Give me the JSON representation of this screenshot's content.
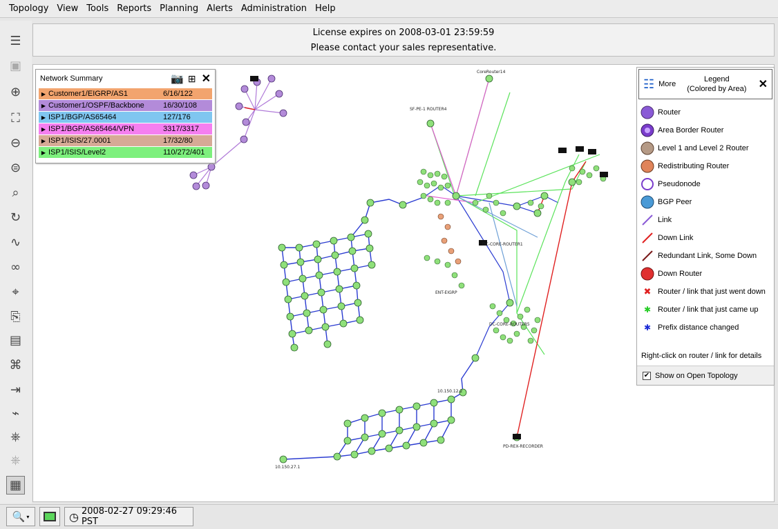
{
  "menu": [
    "Topology",
    "View",
    "Tools",
    "Reports",
    "Planning",
    "Alerts",
    "Administration",
    "Help"
  ],
  "notice": {
    "line1": "License expires on 2008-03-01 23:59:59",
    "line2": "Please contact your sales representative."
  },
  "toolbar": {
    "icons": [
      "tree-icon",
      "save-icon",
      "zoom-in-icon",
      "fit-icon",
      "zoom-out-icon",
      "zoom-region-icon",
      "search-icon",
      "refresh-icon",
      "waveform-icon",
      "path-icon",
      "inspect-icon",
      "router-add-icon",
      "report-icon",
      "topology-icon",
      "list-add-icon",
      "route-icon",
      "group-icon",
      "group-disabled-icon",
      "summary-icon"
    ]
  },
  "summary": {
    "title": "Network Summary",
    "rows": [
      {
        "name": "Customer1/EIGRP/AS1",
        "value": "6/16/122",
        "color": "#f2a46e"
      },
      {
        "name": "Customer1/OSPF/Backbone",
        "value": "16/30/108",
        "color": "#b38bd9"
      },
      {
        "name": "ISP1/BGP/AS65464",
        "value": "127/176",
        "color": "#7fc6f0"
      },
      {
        "name": "ISP1/BGP/AS65464/VPN",
        "value": "3317/3317",
        "color": "#f57ff0"
      },
      {
        "name": "ISP1/ISIS/27.0001",
        "value": "17/32/80",
        "color": "#d6aa96"
      },
      {
        "name": "ISP1/ISIS/Level2",
        "value": "110/272/401",
        "color": "#7df07d"
      }
    ]
  },
  "legend": {
    "more": "More",
    "title1": "Legend",
    "title2": "(Colored by Area)",
    "items": [
      {
        "label": "Router",
        "icon": "router-icon"
      },
      {
        "label": "Area Border Router",
        "icon": "abr-icon"
      },
      {
        "label": "Level 1 and Level 2 Router",
        "icon": "l1l2-router-icon"
      },
      {
        "label": "Redistributing Router",
        "icon": "redistributing-router-icon"
      },
      {
        "label": "Pseudonode",
        "icon": "pseudonode-icon"
      },
      {
        "label": "BGP Peer",
        "icon": "bgp-peer-icon"
      },
      {
        "label": "Link",
        "icon": "link-icon"
      },
      {
        "label": "Down Link",
        "icon": "down-link-icon"
      },
      {
        "label": "Redundant Link, Some Down",
        "icon": "redundant-link-icon"
      },
      {
        "label": "Down Router",
        "icon": "down-router-icon"
      },
      {
        "label": "Router / link that just went down",
        "icon": "went-down-icon"
      },
      {
        "label": "Router / link that just came up",
        "icon": "came-up-icon"
      },
      {
        "label": "Prefix distance changed",
        "icon": "prefix-changed-icon"
      }
    ],
    "hint": "Right-click on router / link for details",
    "show_label": "Show on Open Topology"
  },
  "map_labels": [
    {
      "text": "SF-PE-1 ROUTER4"
    },
    {
      "text": "CoreRouter14"
    },
    {
      "text": "DC-CORE-ROUTER1"
    },
    {
      "text": "DC-CORE-ROUTER5"
    },
    {
      "text": "ENT-EIGRP"
    },
    {
      "text": "PD-REX-RECORDER"
    },
    {
      "text": "10.150.12.2"
    },
    {
      "text": "10.150.27.1"
    }
  ],
  "status": {
    "time": "2008-02-27 09:29:46 PST"
  }
}
